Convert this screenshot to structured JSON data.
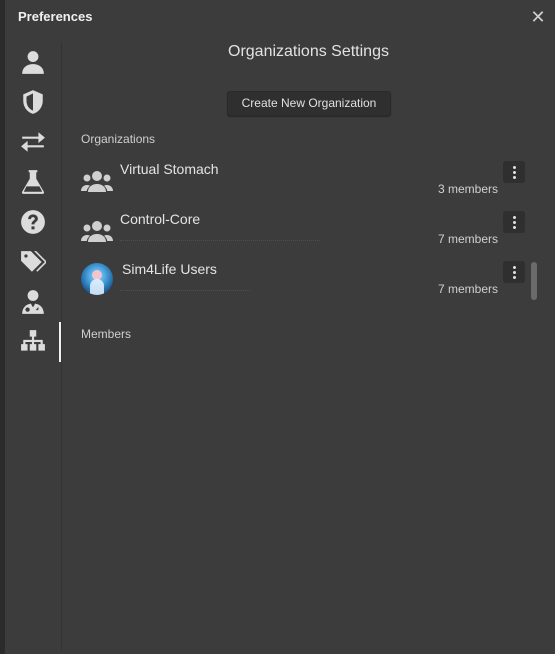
{
  "window": {
    "title": "Preferences",
    "close_symbol": "✕"
  },
  "sidebar": {
    "items": [
      {
        "name": "account",
        "icon": "user-icon"
      },
      {
        "name": "security",
        "icon": "shield-icon"
      },
      {
        "name": "transfer",
        "icon": "arrows-exchange-icon"
      },
      {
        "name": "experimental",
        "icon": "flask-icon"
      },
      {
        "name": "help",
        "icon": "question-circle-icon"
      },
      {
        "name": "tags",
        "icon": "tags-icon"
      },
      {
        "name": "clusters",
        "icon": "user-doctor-icon"
      },
      {
        "name": "organizations",
        "icon": "sitemap-icon",
        "active": true
      }
    ]
  },
  "main": {
    "title": "Organizations Settings",
    "create_button_label": "Create New Organization",
    "organizations_label": "Organizations",
    "members_label": "Members",
    "organizations": [
      {
        "name": "Virtual Stomach",
        "members": "3 members",
        "icon": "users-group-icon"
      },
      {
        "name": "Control-Core",
        "members": "7 members",
        "icon": "users-group-icon"
      },
      {
        "name": "Sim4Life Users",
        "members": "7 members",
        "icon": "avatar-image"
      }
    ]
  }
}
